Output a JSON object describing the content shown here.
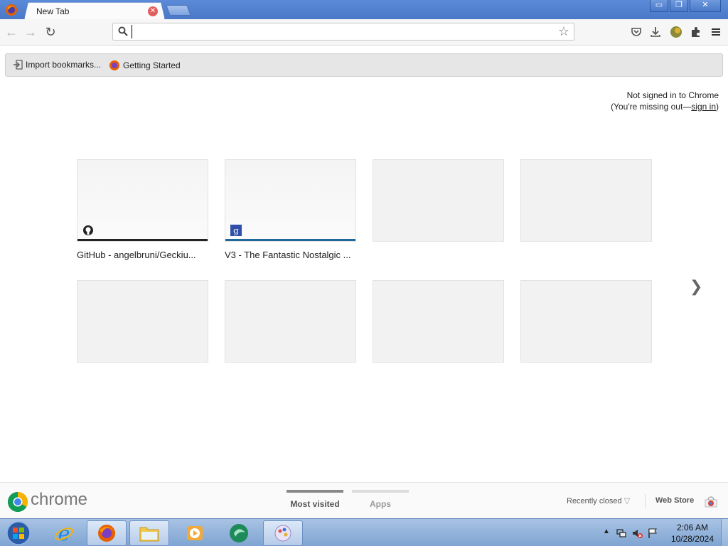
{
  "window": {
    "tab_title": "New Tab",
    "minimize_glyph": "▭",
    "restore_glyph": "❐",
    "close_glyph": "✕"
  },
  "toolbar": {
    "back_glyph": "←",
    "forward_glyph": "→",
    "reload_glyph": "↻",
    "omnibox_value": "",
    "star_glyph": "☆"
  },
  "bookmarks": {
    "import_label": "Import bookmarks...",
    "getting_started_label": "Getting Started"
  },
  "signin": {
    "line1": "Not signed in to Chrome",
    "line2_prefix": "(You're missing out—",
    "link": "sign in",
    "line2_suffix": ")"
  },
  "tiles": [
    {
      "title": "GitHub - angelbruni/Geckiu...",
      "icon": "github-icon",
      "bar_color": "#222222"
    },
    {
      "title": "V3 - The Fantastic Nostalgic ...",
      "icon": "google-icon",
      "bar_color": "#1d6a9a"
    }
  ],
  "next_glyph": "❯",
  "footer": {
    "brand": "chrome",
    "tab_most_visited": "Most visited",
    "tab_apps": "Apps",
    "recently_closed": "Recently closed",
    "web_store": "Web Store",
    "dropdown_glyph": "▽"
  },
  "taskbar": {
    "time": "2:06 AM",
    "date": "10/28/2024"
  },
  "colors": {
    "titlebar": "#4a78c8",
    "accent_active_tab_indicator": "#888888"
  }
}
